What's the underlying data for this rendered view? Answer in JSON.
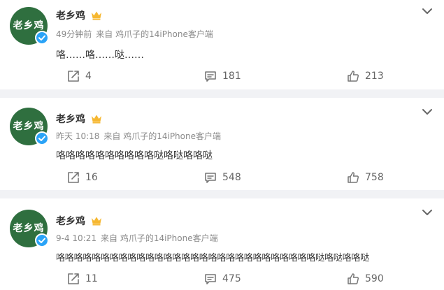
{
  "posts": [
    {
      "author": "老乡鸡",
      "avatar_text": "老乡鸡",
      "time": "49分钟前",
      "source": "来自 鸡爪子的14iPhone客户端",
      "content": "咯……咯……哒……",
      "reposts": "4",
      "comments": "181",
      "likes": "213"
    },
    {
      "author": "老乡鸡",
      "avatar_text": "老乡鸡",
      "time": "昨天 10:18",
      "source": "来自 鸡爪子的14iPhone客户端",
      "content": "咯咯咯咯咯咯咯咯咯咯哒咯哒咯咯哒",
      "reposts": "16",
      "comments": "548",
      "likes": "758"
    },
    {
      "author": "老乡鸡",
      "avatar_text": "老乡鸡",
      "time": "9-4 10:21",
      "source": "来自 鸡爪子的14iPhone客户端",
      "content": "咯咯咯咯咯咯咯咯咯咯咯咯咯咯咯咯咯咯咯咯咯咯咯咯咯咯咯咯咯哒咯哒咯咯哒",
      "reposts": "11",
      "comments": "475",
      "likes": "590"
    }
  ],
  "icons": {
    "repost": "repost-icon",
    "comment": "comment-icon",
    "like": "thumbs-up-icon",
    "more": "chevron-down-icon",
    "verified": "verified-check-icon",
    "member": "crown-icon"
  },
  "colors": {
    "avatar_bg": "#2f6f3f",
    "verified": "#2aa3f7",
    "member_crown": "#f6b730"
  }
}
